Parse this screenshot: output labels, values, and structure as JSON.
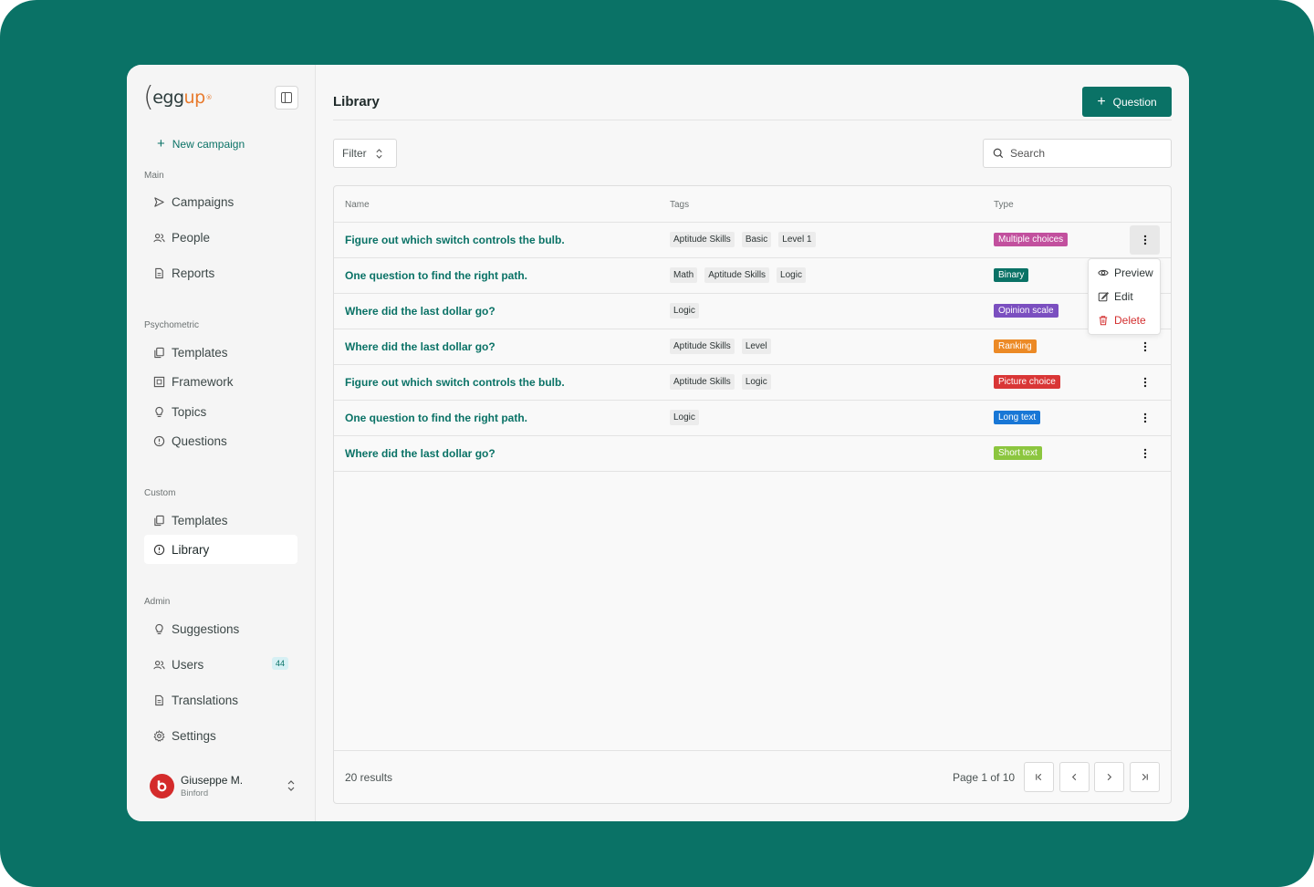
{
  "brand": {
    "logo_text": "egg",
    "logo_accent": "up",
    "logo_mark": "®"
  },
  "sidebar": {
    "new_campaign": "New campaign",
    "sections": {
      "main": "Main",
      "psychometric": "Psychometric",
      "custom": "Custom",
      "admin": "Admin"
    },
    "items": {
      "campaigns": "Campaigns",
      "people": "People",
      "reports": "Reports",
      "psy_templates": "Templates",
      "framework": "Framework",
      "topics": "Topics",
      "questions": "Questions",
      "custom_templates": "Templates",
      "library": "Library",
      "suggestions": "Suggestions",
      "users": "Users",
      "users_badge": "44",
      "translations": "Translations",
      "settings": "Settings"
    },
    "user": {
      "name": "Giuseppe M.",
      "org": "Binford"
    }
  },
  "header": {
    "title": "Library",
    "add_button": "Question"
  },
  "toolbar": {
    "filter_label": "Filter",
    "search_placeholder": "Search"
  },
  "table": {
    "columns": {
      "name": "Name",
      "tags": "Tags",
      "type": "Type"
    },
    "rows": [
      {
        "name": "Figure out which switch controls the bulb.",
        "tags": [
          "Aptitude Skills",
          "Basic",
          "Level 1"
        ],
        "type": "Multiple choices",
        "type_color": "#c2509e"
      },
      {
        "name": "One question to find the right path.",
        "tags": [
          "Math",
          "Aptitude Skills",
          "Logic"
        ],
        "type": "Binary",
        "type_color": "#0a7266"
      },
      {
        "name": "Where did the last dollar go?",
        "tags": [
          "Logic"
        ],
        "type": "Opinion scale",
        "type_color": "#7b4fc0"
      },
      {
        "name": "Where did the last dollar go?",
        "tags": [
          "Aptitude Skills",
          "Level"
        ],
        "type": "Ranking",
        "type_color": "#ec8a26"
      },
      {
        "name": "Figure out which switch controls the bulb.",
        "tags": [
          "Aptitude Skills",
          "Logic"
        ],
        "type": "Picture choice",
        "type_color": "#d93636"
      },
      {
        "name": "One question to find the right path.",
        "tags": [
          "Logic"
        ],
        "type": "Long text",
        "type_color": "#1877d6"
      },
      {
        "name": "Where did the last dollar go?",
        "tags": [],
        "type": "Short text",
        "type_color": "#8cc63f"
      }
    ],
    "row_menu": {
      "preview": "Preview",
      "edit": "Edit",
      "delete": "Delete"
    }
  },
  "footer": {
    "results": "20 results",
    "page_info": "Page 1 of 10"
  }
}
